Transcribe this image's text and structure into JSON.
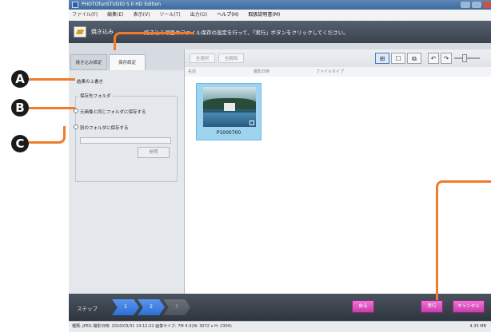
{
  "window": {
    "title": "PHOTOfunSTUDIO 5.0 HD Edition"
  },
  "menu": [
    "ファイル(F)",
    "編集(E)",
    "表示(V)",
    "ツール(T)",
    "出力(O)",
    "ヘルプ(H)",
    "取扱説明書(M)"
  ],
  "banner": {
    "title": "焼き込み",
    "instruction": "焼き込み項目やファイル保存の設定を行って、「実行」ボタンをクリックしてください。"
  },
  "tabs": [
    {
      "label": "焼き込み設定",
      "active": false
    },
    {
      "label": "保存設定",
      "active": true
    }
  ],
  "settings": {
    "overwrite_label": "結果の上書き",
    "folder_group_label": "保存先フォルダ",
    "same_folder_label": "元画像と同じフォルダに保存する",
    "other_folder_label": "別のフォルダに保存する",
    "browse_label": "参照"
  },
  "toolbar": {
    "select_all": "全選択",
    "deselect_all": "全解除"
  },
  "columns": [
    "名前",
    "撮影日時",
    "ファイルタイプ"
  ],
  "thumbnails": [
    {
      "filename": "P1000700",
      "selected": true
    }
  ],
  "steps": {
    "label": "ステップ",
    "items": [
      "1",
      "2",
      "3"
    ]
  },
  "buttons": {
    "back": "戻る",
    "execute": "実行",
    "cancel": "キャンセル"
  },
  "status": {
    "info": "種類: JPEG  撮影日時: 2010/03/31 14:12:22  画像サイズ: 7M 4:3(W: 3072 x H: 2304)",
    "size": "4.35 MB"
  },
  "annotations": {
    "markers": [
      "A",
      "B",
      "C"
    ],
    "callout_color": "#f07c2a"
  },
  "colors": {
    "accent_pink": "#d94fbb",
    "step_blue": "#2d6fd6"
  }
}
